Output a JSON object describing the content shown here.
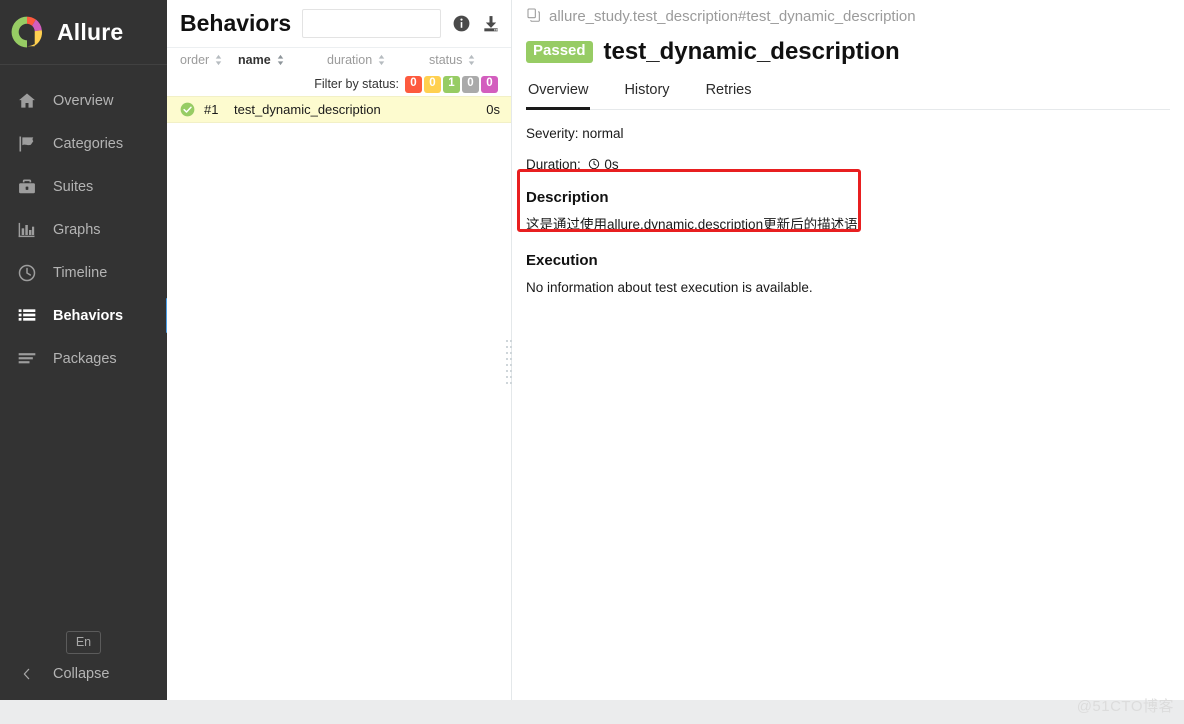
{
  "brand": {
    "name": "Allure",
    "logo_colors": [
      "#97cc64",
      "#fd5a3e",
      "#d35ebe",
      "#ffd050"
    ]
  },
  "sidebar": {
    "items": [
      {
        "label": "Overview",
        "icon": "home-icon",
        "active": false
      },
      {
        "label": "Categories",
        "icon": "flag-icon",
        "active": false
      },
      {
        "label": "Suites",
        "icon": "briefcase-icon",
        "active": false
      },
      {
        "label": "Graphs",
        "icon": "bar-chart-icon",
        "active": false
      },
      {
        "label": "Timeline",
        "icon": "clock-icon",
        "active": false
      },
      {
        "label": "Behaviors",
        "icon": "list-icon",
        "active": true
      },
      {
        "label": "Packages",
        "icon": "layers-icon",
        "active": false
      }
    ],
    "language_button": "En",
    "collapse_label": "Collapse",
    "accent_color": "#4a9fe8"
  },
  "list_pane": {
    "title": "Behaviors",
    "search": {
      "value": "",
      "placeholder": ""
    },
    "icons": [
      {
        "name": "info-icon"
      },
      {
        "name": "download-icon"
      }
    ],
    "columns": [
      {
        "key": "order",
        "label": "order",
        "sorted": false
      },
      {
        "key": "name",
        "label": "name",
        "sorted": true
      },
      {
        "key": "duration",
        "label": "duration",
        "sorted": false
      },
      {
        "key": "status",
        "label": "status",
        "sorted": false
      }
    ],
    "filter": {
      "label": "Filter by status:",
      "badges": [
        {
          "status": "failed",
          "count": "0",
          "color": "#fd5a3e"
        },
        {
          "status": "broken",
          "count": "0",
          "color": "#ffd050"
        },
        {
          "status": "passed",
          "count": "1",
          "color": "#97cc64"
        },
        {
          "status": "skipped",
          "count": "0",
          "color": "#aaaaaa"
        },
        {
          "status": "unknown",
          "count": "0",
          "color": "#d35ebe"
        }
      ]
    },
    "rows": [
      {
        "order": "#1",
        "name": "test_dynamic_description",
        "duration": "0s",
        "status": "passed",
        "status_color": "#97cc64",
        "selected": true
      }
    ]
  },
  "detail": {
    "breadcrumb": "allure_study.test_description#test_dynamic_description",
    "copy_icon": "copy-icon",
    "status_badge": {
      "label": "Passed",
      "color": "#97cc64"
    },
    "title": "test_dynamic_description",
    "tabs": [
      {
        "label": "Overview",
        "active": true
      },
      {
        "label": "History",
        "active": false
      },
      {
        "label": "Retries",
        "active": false
      }
    ],
    "severity_line": "Severity: normal",
    "duration_label": "Duration:",
    "duration_value": "0s",
    "description": {
      "heading": "Description",
      "text": "这是通过使用allure.dynamic.description更新后的描述语",
      "highlight_color": "#e81f20"
    },
    "execution": {
      "heading": "Execution",
      "text": "No information about test execution is available."
    }
  },
  "watermark": "@51CTO博客"
}
